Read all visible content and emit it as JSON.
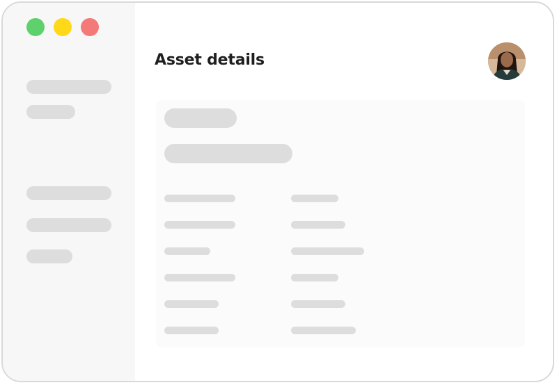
{
  "window": {
    "controls": [
      {
        "name": "green-dot",
        "color": "#5fd16c"
      },
      {
        "name": "yellow-dot",
        "color": "#ffd817"
      },
      {
        "name": "red-dot",
        "color": "#f47a7a"
      }
    ]
  },
  "header": {
    "title": "Asset details",
    "avatar_icon": "user-avatar"
  },
  "colors": {
    "placeholder": "#dddddd",
    "sidebar_bg": "#f7f7f7",
    "panel_bg": "#fbfbfb",
    "title_text": "#1f1f1f"
  }
}
